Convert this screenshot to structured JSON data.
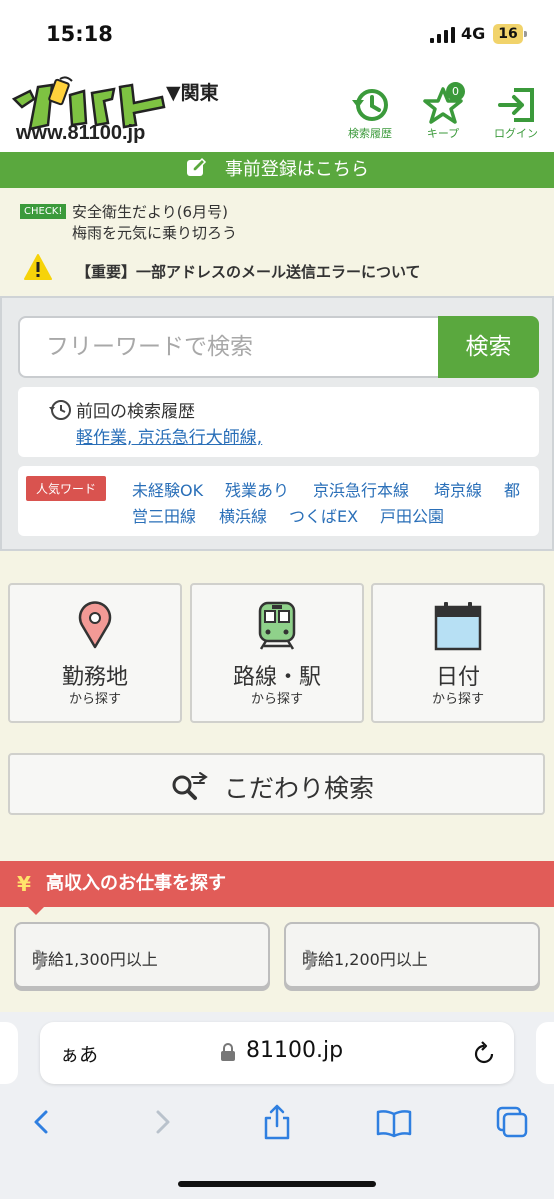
{
  "status_bar": {
    "time": "15:18",
    "network": "4G",
    "battery": "16"
  },
  "header": {
    "logo_url": "www.81100.jp",
    "region": "▼関東",
    "history_label": "検索履歴",
    "keep_label": "キープ",
    "keep_count": "0",
    "login_label": "ログイン"
  },
  "register_bar": {
    "label": "事前登録はこちら"
  },
  "news": {
    "check_badge": "CHECK!",
    "line1": "安全衛生だより(6月号)",
    "line2": "梅雨を元気に乗り切ろう"
  },
  "alert": {
    "text": "【重要】一部アドレスのメール送信エラーについて"
  },
  "search": {
    "placeholder": "フリーワードで検索",
    "button": "検索",
    "history_title": "前回の検索履歴",
    "history_link": "軽作業, 京浜急行大師線,",
    "popular_label": "人気ワード",
    "popular_words": [
      "未経験OK",
      "残業あり",
      "京浜急行本線",
      "埼京線",
      "都",
      "営三田線",
      "横浜線",
      "つくばEX",
      "戸田公園"
    ]
  },
  "tiles": [
    {
      "title": "勤務地",
      "sub": "から探す",
      "icon": "map-pin-icon"
    },
    {
      "title": "路線・駅",
      "sub": "から探す",
      "icon": "train-icon"
    },
    {
      "title": "日付",
      "sub": "から探す",
      "icon": "calendar-icon"
    }
  ],
  "kodawari": {
    "label": "こだわり検索"
  },
  "income": {
    "yen": "¥",
    "title": "高収入のお仕事を探す",
    "wage1": "時給1,300円以上",
    "wage2": "時給1,200円以上"
  },
  "browser": {
    "aa": "ぁあ",
    "host": "81100.jp"
  },
  "colors": {
    "brand_green": "#5aa83e",
    "alert_red": "#e15c58",
    "link_blue": "#2a6fb8"
  }
}
